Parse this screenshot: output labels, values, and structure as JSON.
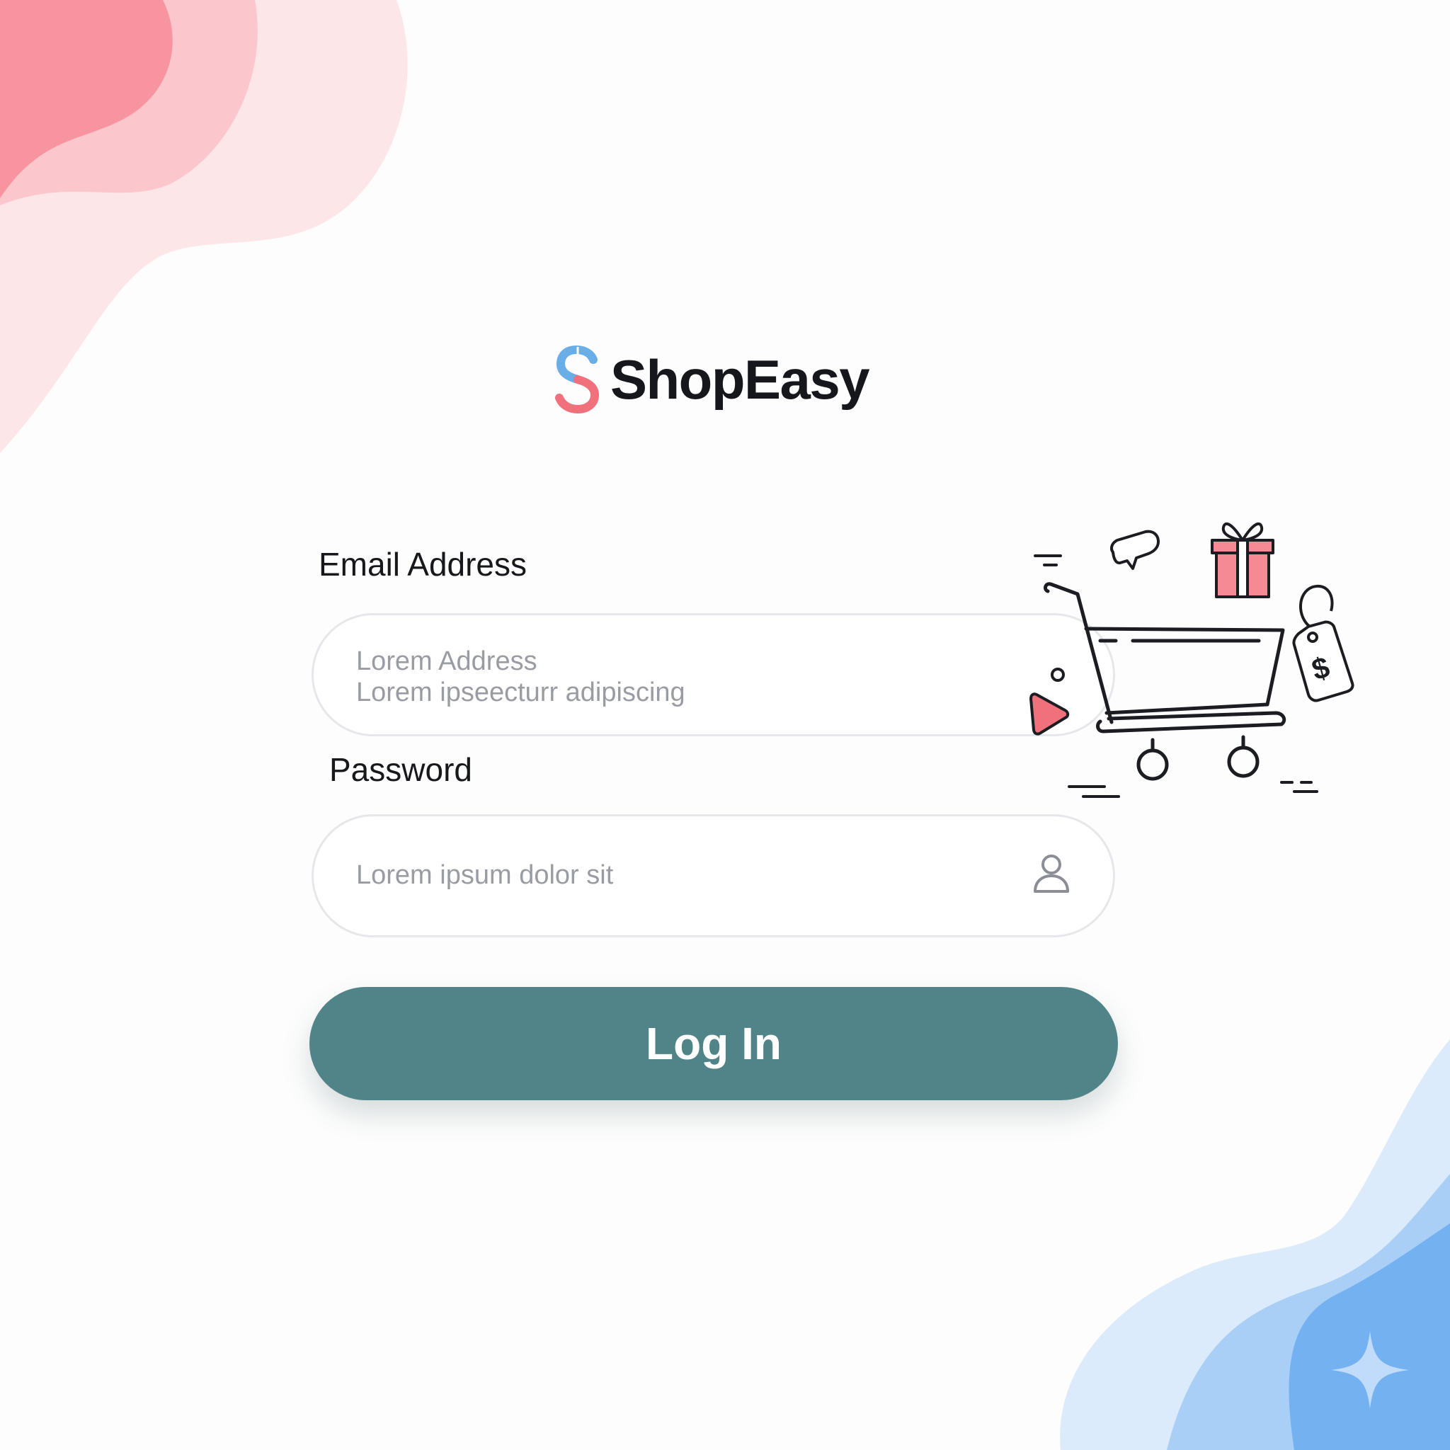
{
  "brand": {
    "name": "ShopEasy",
    "logo_icon": "s-logo-icon",
    "logo_colors": [
      "#6aaee8",
      "#f0707c"
    ]
  },
  "form": {
    "email": {
      "label": "Email Address",
      "placeholder_line1": "Lorem Address",
      "placeholder_line2": "Lorem ipseecturr adipiscing"
    },
    "password": {
      "label": "Password",
      "placeholder": "Lorem ipsum dolor sit",
      "icon": "user-icon"
    },
    "submit_label": "Log In"
  },
  "illustration": {
    "icons": [
      "shopping-cart-icon",
      "gift-icon",
      "price-tag-icon",
      "speech-bubble-icon",
      "play-icon"
    ],
    "price_symbol": "$"
  },
  "colors": {
    "accent": "#518488",
    "pink_blob": "#f8a3ad",
    "blue_blob": "#8fc2f5",
    "field_border": "#e6e7ea",
    "placeholder": "#9a9ca3"
  }
}
